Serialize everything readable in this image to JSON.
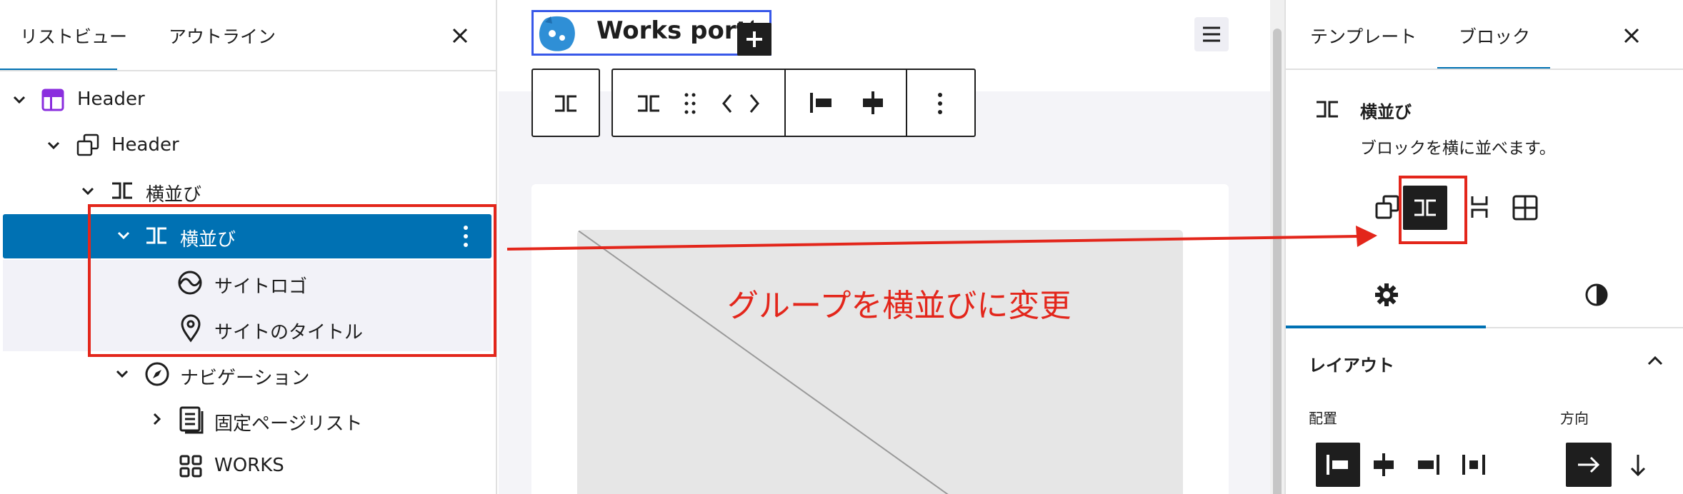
{
  "list_view": {
    "tabs": [
      "リストビュー",
      "アウトライン"
    ],
    "active_tab": 0,
    "items": [
      {
        "label": "Header",
        "icon": "template-part-icon",
        "expanded": true
      },
      {
        "label": "Header",
        "icon": "group-icon",
        "expanded": true
      },
      {
        "label": "横並び",
        "icon": "row-icon",
        "expanded": true
      },
      {
        "label": "横並び",
        "icon": "row-icon",
        "expanded": true,
        "selected": true
      },
      {
        "label": "サイトロゴ",
        "icon": "site-logo-icon"
      },
      {
        "label": "サイトのタイトル",
        "icon": "map-marker-icon"
      },
      {
        "label": "ナビゲーション",
        "icon": "navigation-icon",
        "expanded": true
      },
      {
        "label": "固定ページリスト",
        "icon": "page-list-icon",
        "expanded": false
      },
      {
        "label": "WORKS",
        "icon": "grid-icon"
      }
    ]
  },
  "canvas": {
    "site_title": "Works portfo",
    "annotation": "グループを横並びに変更"
  },
  "inspector": {
    "tabs": [
      "テンプレート",
      "ブロック"
    ],
    "active_tab": 1,
    "block": {
      "name": "横並び",
      "description": "ブロックを横に並べます。"
    },
    "variations": [
      "group-icon",
      "row-icon",
      "stack-icon",
      "grid-icon"
    ],
    "active_variation": 1,
    "settings_tabs": [
      "gear-icon",
      "styles-icon"
    ],
    "layout_panel": {
      "title": "レイアウト",
      "justification_label": "配置",
      "orientation_label": "方向"
    }
  },
  "colors": {
    "accent": "#0071b3",
    "highlight": "#e3261b",
    "dark": "#1e1e1e",
    "wp_blue": "#3858e9"
  }
}
